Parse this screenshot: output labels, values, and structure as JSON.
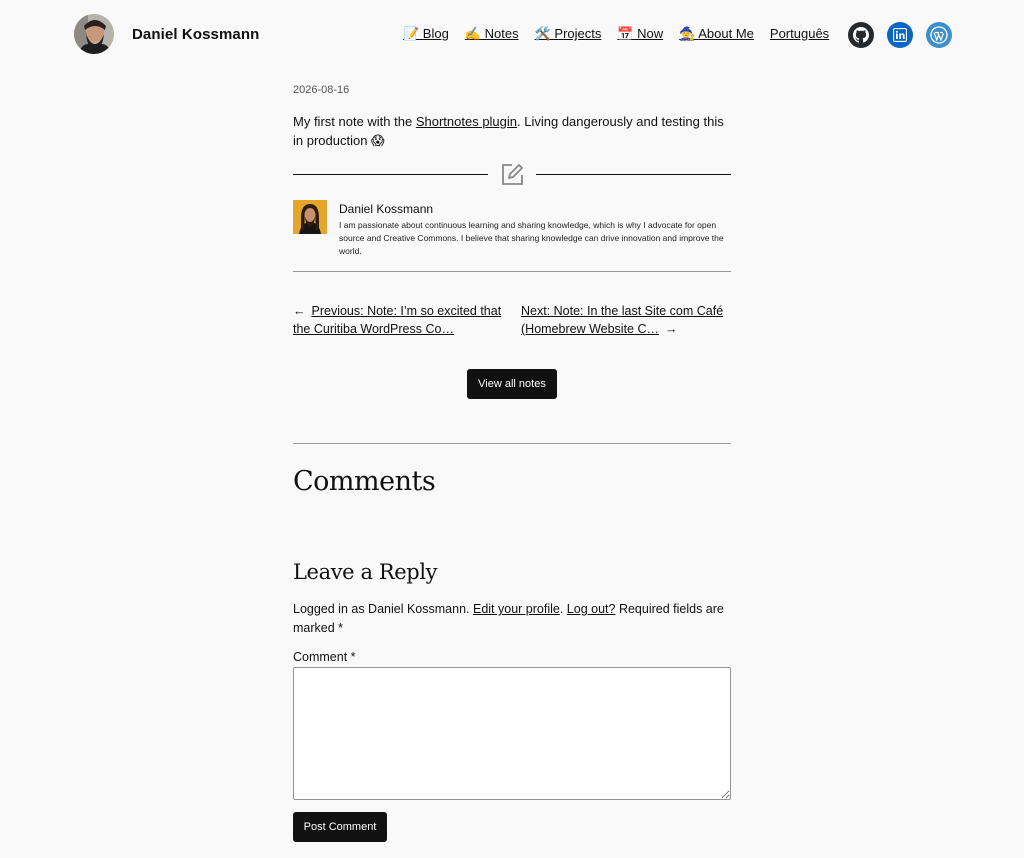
{
  "header": {
    "site_title": "Daniel Kossmann",
    "nav": [
      {
        "label": "📝 Blog"
      },
      {
        "label": "✍️ Notes"
      },
      {
        "label": "🛠️ Projects"
      },
      {
        "label": "📅 Now"
      },
      {
        "label": "🧙 About Me"
      },
      {
        "label": "Português"
      }
    ],
    "social": [
      {
        "name": "github-icon"
      },
      {
        "name": "linkedin-icon"
      },
      {
        "name": "wordpress-icon"
      }
    ]
  },
  "note": {
    "date": "2026-08-16",
    "text_before": "My first note with the ",
    "link_text": "Shortnotes plugin",
    "text_after": ". Living dangerously and testing this in production 😱"
  },
  "author": {
    "name": "Daniel Kossmann",
    "bio": "I am passionate about continuous learning and sharing knowledge, which is why I advocate for open source and Creative Commons. I believe that sharing knowledge can drive innovation and improve the world."
  },
  "post_nav": {
    "prev_arrow": "←",
    "prev_label": "Previous: Note: I’m so excited that the Curitiba WordPress Co…",
    "next_label": "Next: Note: In the last Site com Café (Homebrew Website C…",
    "next_arrow": "→"
  },
  "view_all_label": "View all notes",
  "comments": {
    "title": "Comments",
    "reply_title": "Leave a Reply",
    "logged_in_prefix": "Logged in as Daniel Kossmann. ",
    "edit_profile": "Edit your profile",
    "separator": ". ",
    "log_out": "Log out?",
    "required_text": " Required fields are marked ",
    "required_mark": "*",
    "comment_label": "Comment *",
    "comment_value": "",
    "submit_label": "Post Comment"
  },
  "colors": {
    "background": "#f9f9f9",
    "button": "#111111",
    "github": "#24292e",
    "linkedin": "#0a66c2",
    "wordpress": "#3d8fc9"
  }
}
